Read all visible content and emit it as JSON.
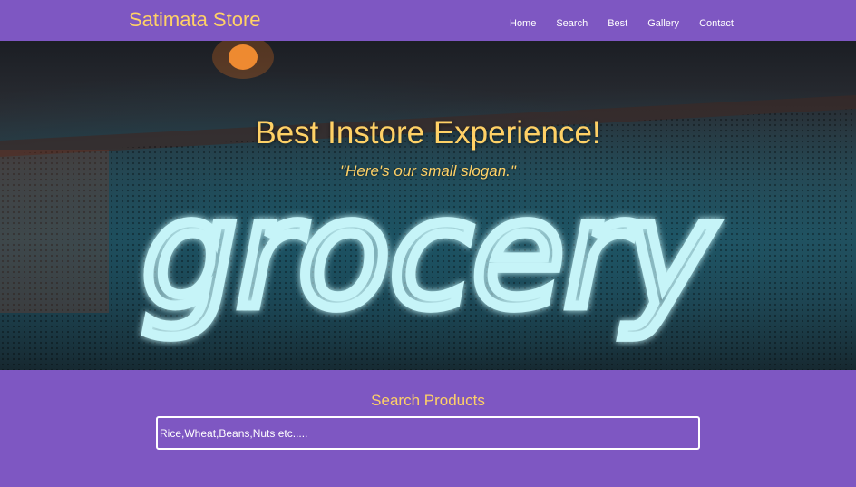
{
  "navbar": {
    "brand": "Satimata Store",
    "links": [
      {
        "label": "Home"
      },
      {
        "label": "Search"
      },
      {
        "label": "Best"
      },
      {
        "label": "Gallery"
      },
      {
        "label": "Contact"
      }
    ]
  },
  "hero": {
    "title": "Best Instore Experience!",
    "slogan": "\"Here's our small slogan.\"",
    "sign_text": "grocery"
  },
  "search": {
    "title": "Search Products",
    "placeholder": "Rice,Wheat,Beans,Nuts etc.....",
    "value": ""
  },
  "colors": {
    "primary": "#7e57c2",
    "accent": "#ffd166",
    "nav_text": "#ffffff",
    "neon": "#c6f4f8"
  }
}
